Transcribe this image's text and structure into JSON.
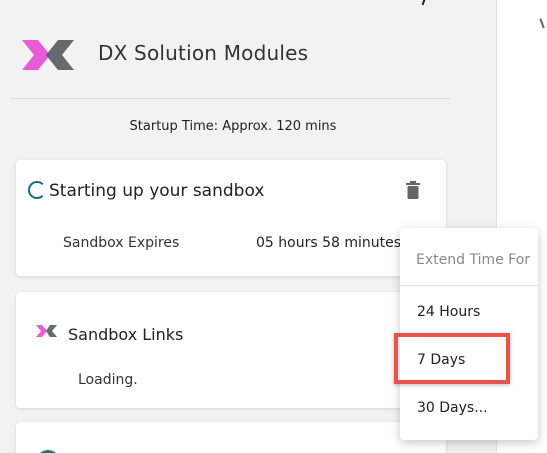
{
  "header": {
    "app_title": "DX Solution Modules",
    "startup_time": "Startup Time: Approx. 120 mins"
  },
  "sandbox_card": {
    "status_title": "Starting up your sandbox",
    "expires_label": "Sandbox Expires",
    "expires_value": "05 hours 58 minutes"
  },
  "links_card": {
    "title": "Sandbox Links",
    "loading_text": "Loading."
  },
  "extend_menu": {
    "header": "Extend Time For",
    "options": [
      "24 Hours",
      "7 Days",
      "30 Days..."
    ],
    "highlighted_option": "7 Days"
  },
  "colors": {
    "accent_teal": "#1b6b88",
    "logo_pink": "#e85bd6",
    "logo_gray": "#555b61",
    "highlight_red": "#e8544d"
  },
  "icons": [
    "dx-logo-icon",
    "spinner-icon",
    "trash-icon",
    "dx-small-logo-icon"
  ]
}
